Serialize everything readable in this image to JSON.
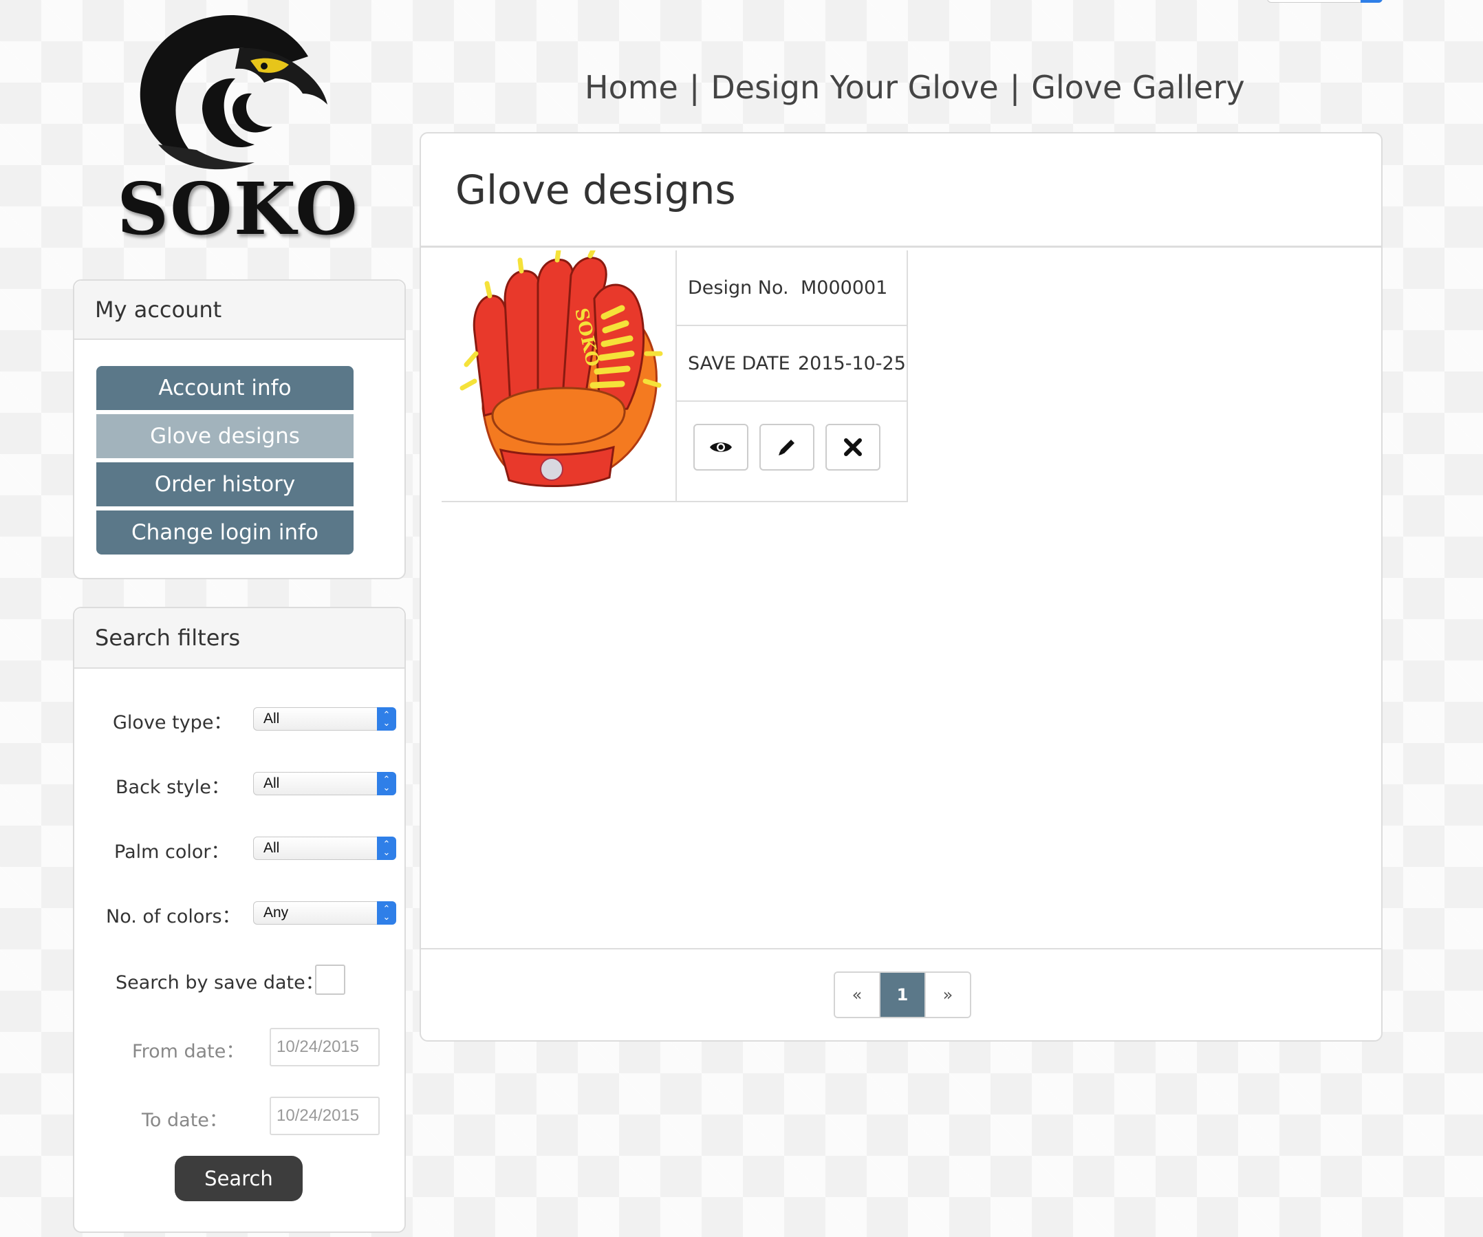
{
  "brand": {
    "logo_text": "SOKO"
  },
  "nav": {
    "home": "Home",
    "design": "Design Your Glove",
    "gallery": "Glove Gallery",
    "separator": "|"
  },
  "account": {
    "title": "My account",
    "items": [
      {
        "label": "Account info",
        "active": false
      },
      {
        "label": "Glove designs",
        "active": true
      },
      {
        "label": "Order history",
        "active": false
      },
      {
        "label": "Change login info",
        "active": false
      }
    ]
  },
  "filters": {
    "title": "Search filters",
    "glove_type": {
      "label": "Glove type：",
      "value": "All"
    },
    "back_style": {
      "label": "Back style：",
      "value": "All"
    },
    "palm_color": {
      "label": "Palm color：",
      "value": "All"
    },
    "num_colors": {
      "label": "No. of colors：",
      "value": "Any"
    },
    "save_date": {
      "label": "Search by save date：",
      "checked": false
    },
    "from_date": {
      "label": "From date：",
      "value": "10/24/2015"
    },
    "to_date": {
      "label": "To date：",
      "value": "10/24/2015"
    },
    "search_label": "Search"
  },
  "main": {
    "title": "Glove designs",
    "designs": [
      {
        "glove_logo": "SOKO",
        "design_no_label": "Design No.",
        "design_no": "M000001",
        "save_date_label": "SAVE DATE",
        "save_date": "2015-10-25",
        "actions": [
          "eye-icon",
          "pencil-icon",
          "close-icon"
        ]
      }
    ]
  },
  "pagination": {
    "prev": "«",
    "current": "1",
    "next": "»"
  },
  "colors": {
    "accent": "#5b7889",
    "accent_light": "#a2b3bc",
    "glove_red": "#e8392b",
    "glove_orange": "#f47a20",
    "lace_yellow": "#f5e23a"
  }
}
